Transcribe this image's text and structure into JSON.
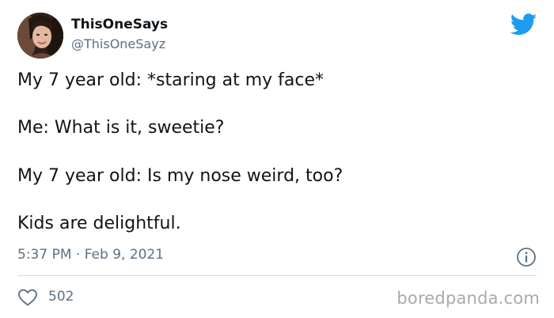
{
  "author": {
    "display_name": "ThisOneSays",
    "handle": "@ThisOneSayz"
  },
  "tweet": {
    "lines": [
      "My 7 year old: *staring at my face*",
      "Me: What is it, sweetie?",
      "My 7 year old: Is my nose weird, too?",
      "Kids are delightful."
    ],
    "timestamp": "5:37 PM · Feb 9, 2021"
  },
  "engagement": {
    "likes": "502"
  },
  "watermark": "boredpanda.com",
  "icons": {
    "brand": "twitter-bird-icon",
    "info": "info-icon",
    "like": "heart-icon"
  },
  "colors": {
    "twitter_blue": "#1d9bf0",
    "text": "#0f1419",
    "muted": "#5b7083",
    "divider": "#cfd9de"
  }
}
